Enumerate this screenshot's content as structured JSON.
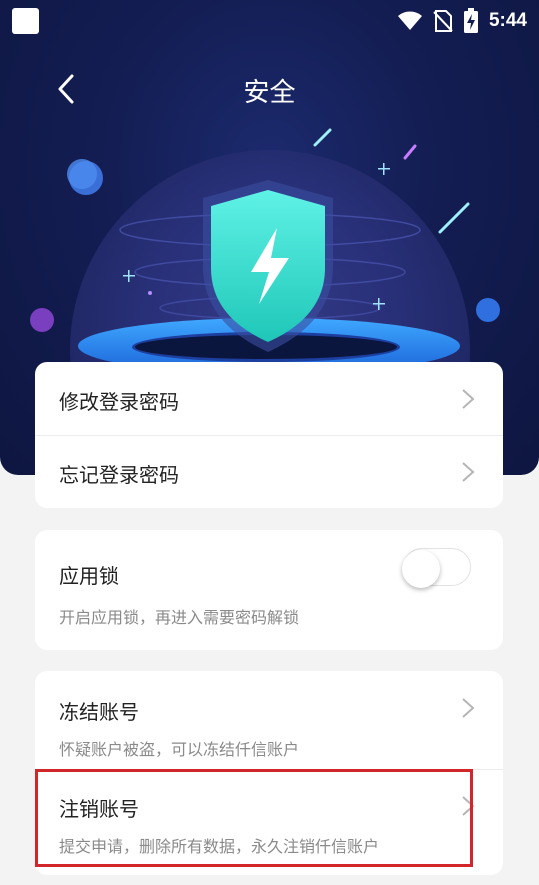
{
  "status_bar": {
    "time": "5:44"
  },
  "header": {
    "title": "安全"
  },
  "security_card": {
    "items": [
      {
        "label": "修改登录密码"
      },
      {
        "label": "忘记登录密码"
      }
    ]
  },
  "app_lock": {
    "title": "应用锁",
    "description": "开启应用锁，再进入需要密码解锁",
    "enabled": false
  },
  "account_card": {
    "freeze": {
      "title": "冻结账号",
      "description": "怀疑账户被盗，可以冻结仟信账户"
    },
    "cancel": {
      "title": "注销账号",
      "description": "提交申请，删除所有数据，永久注销仟信账户"
    }
  },
  "colors": {
    "hero_bg": "#131d52",
    "shield": "#3ee0d0",
    "highlight": "#d3262b"
  }
}
